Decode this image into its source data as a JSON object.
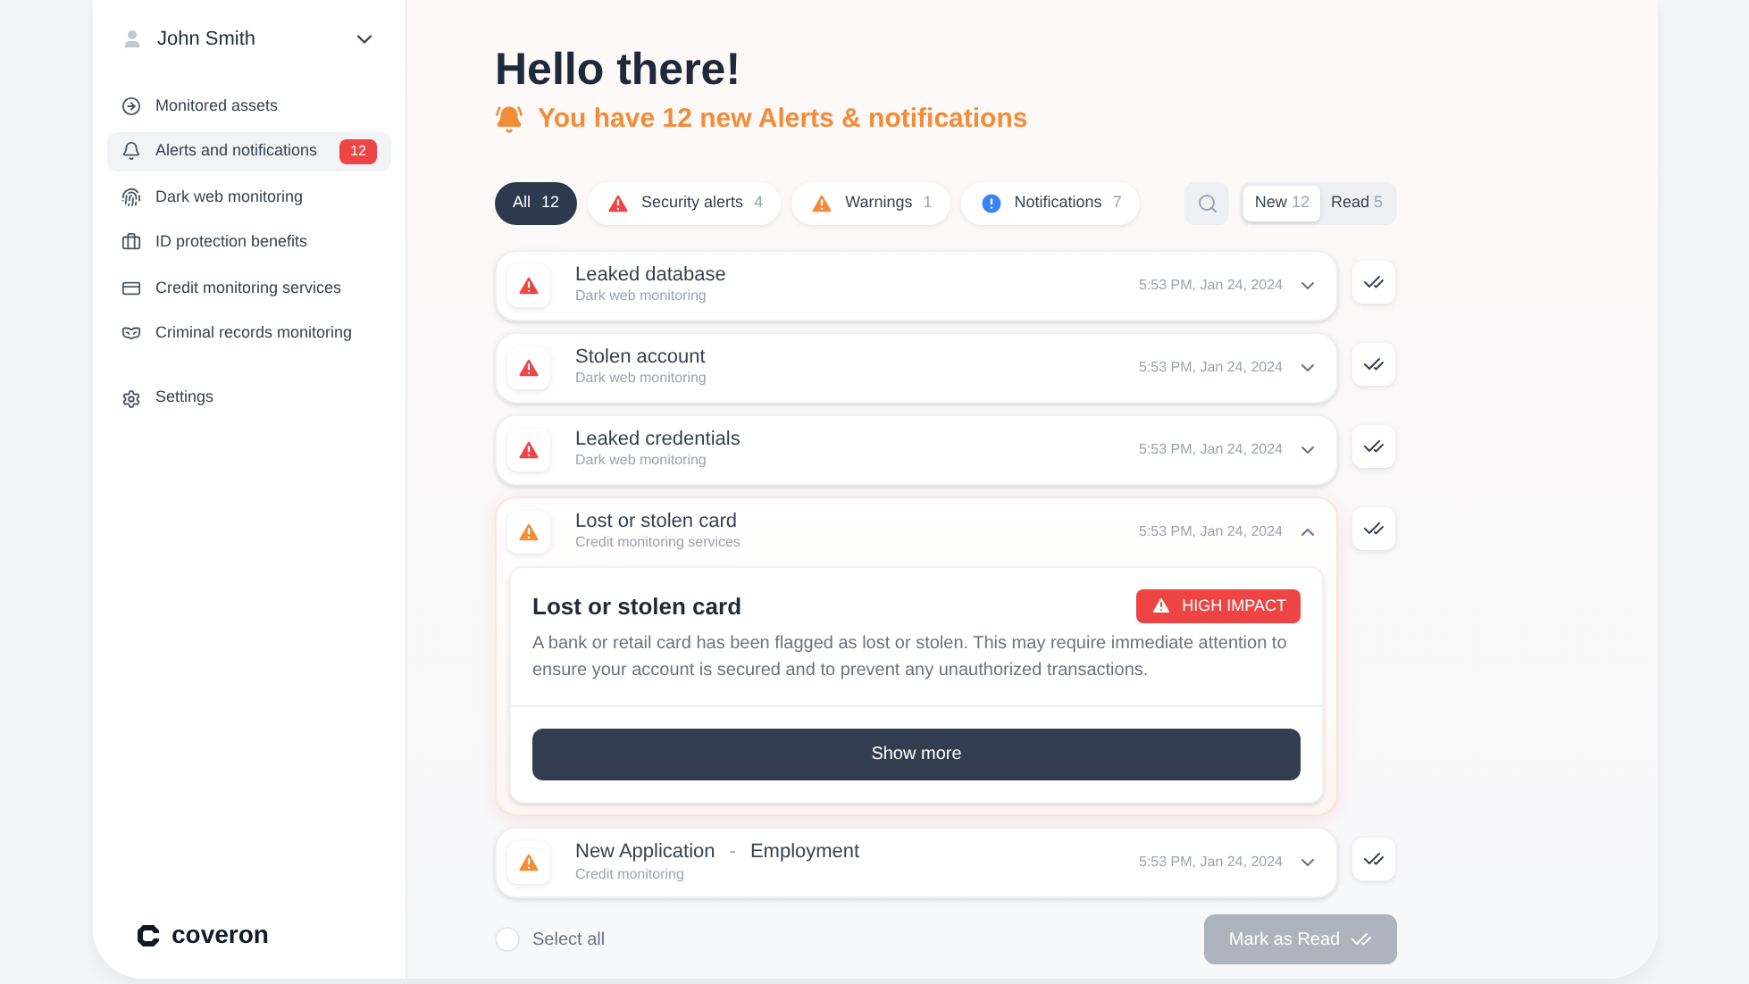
{
  "user": {
    "name": "John Smith"
  },
  "sidebar": {
    "items": [
      {
        "label": "Monitored assets",
        "selected": false
      },
      {
        "label": "Alerts and notifications",
        "selected": true,
        "badge": "12"
      },
      {
        "label": "Dark web monitoring",
        "selected": false
      },
      {
        "label": "ID protection benefits",
        "selected": false
      },
      {
        "label": "Credit monitoring services",
        "selected": false
      },
      {
        "label": "Criminal records monitoring",
        "selected": false
      }
    ],
    "settings": "Settings",
    "logo": "coveron"
  },
  "header": {
    "title": "Hello there!",
    "subtitle": "You have 12 new Alerts & notifications"
  },
  "filters": [
    {
      "label": "All",
      "count": "12",
      "kind": "all",
      "selected": true
    },
    {
      "label": "Security alerts",
      "count": "4",
      "kind": "danger",
      "selected": false
    },
    {
      "label": "Warnings",
      "count": "1",
      "kind": "warning",
      "selected": false
    },
    {
      "label": "Notifications",
      "count": "7",
      "kind": "info",
      "selected": false
    }
  ],
  "read_toggle": [
    {
      "label": "New",
      "count": "12",
      "selected": true
    },
    {
      "label": "Read",
      "count": "5",
      "selected": false
    }
  ],
  "alerts": [
    {
      "title": "Leaked database",
      "source": "Dark web monitoring",
      "time": "5:53 PM, Jan 24, 2024",
      "kind": "danger",
      "expanded": false
    },
    {
      "title": "Stolen account",
      "source": "Dark web monitoring",
      "time": "5:53 PM, Jan 24, 2024",
      "kind": "danger",
      "expanded": false
    },
    {
      "title": "Leaked credentials",
      "source": "Dark web monitoring",
      "time": "5:53 PM, Jan 24, 2024",
      "kind": "danger",
      "expanded": false
    },
    {
      "title": "Lost or stolen card",
      "source": "Credit monitoring services",
      "time": "5:53 PM, Jan 24, 2024",
      "kind": "warning",
      "expanded": true,
      "detail": {
        "title": "Lost or stolen card",
        "badge": "HIGH IMPACT",
        "body": "A bank or retail card has been flagged as lost or stolen. This may require immediate attention to ensure your account is secured and to prevent any unauthorized transactions.",
        "button": "Show more"
      }
    },
    {
      "title": "New Application",
      "separator": "-",
      "title_extra": "Employment",
      "source": "Credit monitoring",
      "time": "5:53 PM, Jan 24, 2024",
      "kind": "warning",
      "expanded": false
    }
  ],
  "footer": {
    "select_all": {
      "label": "Select all",
      "checked": false
    },
    "mark_button": {
      "label": "Mark as Read",
      "disabled": true
    }
  }
}
